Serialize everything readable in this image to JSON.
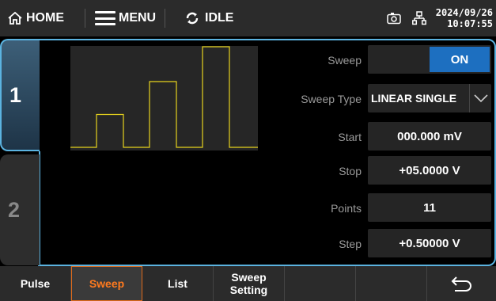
{
  "topbar": {
    "home_label": "HOME",
    "menu_label": "MENU",
    "status_label": "IDLE",
    "date": "2024/09/26",
    "time": "10:07:55"
  },
  "channels": [
    {
      "label": "1",
      "selected": true
    },
    {
      "label": "2",
      "selected": false
    }
  ],
  "sweep_preview": {
    "type": "step",
    "steps": [
      1,
      2,
      3
    ],
    "line_color": "#e6d21e"
  },
  "params": {
    "sweep": {
      "label": "Sweep",
      "value": "ON"
    },
    "sweep_type": {
      "label": "Sweep Type",
      "value": "LINEAR SINGLE"
    },
    "start": {
      "label": "Start",
      "value": "000.000 mV"
    },
    "stop": {
      "label": "Stop",
      "value": "+05.0000 V"
    },
    "points": {
      "label": "Points",
      "value": "11"
    },
    "step": {
      "label": "Step",
      "value": "+0.50000 V"
    }
  },
  "bottombar": {
    "pulse": "Pulse",
    "sweep": "Sweep",
    "list": "List",
    "sweep_setting_1": "Sweep",
    "sweep_setting_2": "Setting",
    "active": "Sweep"
  },
  "colors": {
    "accent": "#5bb3e0",
    "active_tab": "#ff7a1e",
    "on_button": "#1d6fc0",
    "chart_line": "#e6d21e"
  }
}
